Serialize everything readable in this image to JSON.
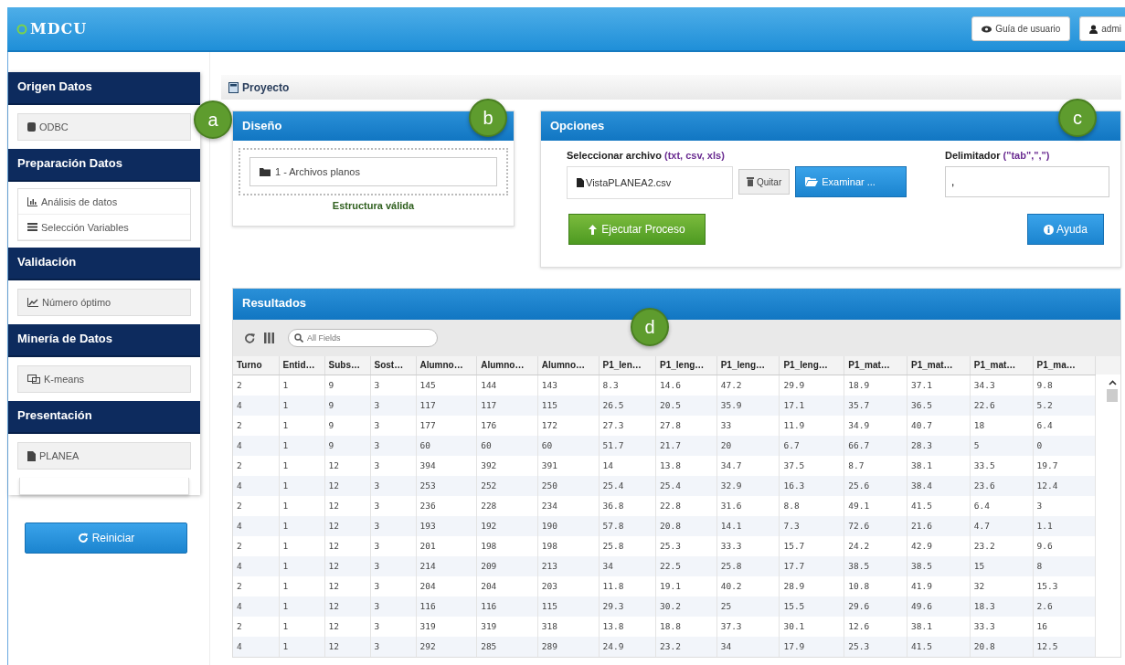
{
  "header": {
    "logo": "MDCU",
    "buttons": [
      {
        "label": "Guía de usuario"
      },
      {
        "label": "admi"
      }
    ]
  },
  "sidebar": {
    "sections": [
      {
        "title": "Origen Datos",
        "items": [
          "ODBC"
        ]
      },
      {
        "title": "Preparación Datos",
        "items": [
          "Análisis de datos",
          "Selección Variables"
        ]
      },
      {
        "title": "Validación",
        "items": [
          "Número óptimo"
        ]
      },
      {
        "title": "Minería de Datos",
        "items": [
          "K-means"
        ]
      },
      {
        "title": "Presentación",
        "items": [
          "PLANEA"
        ]
      }
    ],
    "reset_button": "Reiniciar"
  },
  "project": {
    "title": "Proyecto"
  },
  "design": {
    "title": "Diseño",
    "item": "1 - Archivos planos",
    "status": "Estructura válida"
  },
  "options": {
    "title": "Opciones",
    "file_label": "Seleccionar archivo",
    "file_types": "(txt, csv, xls)",
    "file_value": "VistaPLANEA2.csv",
    "remove_button": "Quitar",
    "browse_button": "Examinar ...",
    "delimiter_label": "Delimitador",
    "delimiter_hint": "(\"tab\",\",\")",
    "delimiter_value": ",",
    "run_button": "Ejecutar Proceso",
    "help_button": "Ayuda"
  },
  "results": {
    "title": "Resultados",
    "search": {
      "placeholder": "All Fields"
    },
    "columns": [
      "Turno",
      "Entid…",
      "Subs…",
      "Sost…",
      "Alumno…",
      "Alumno…",
      "Alumno…",
      "P1_len…",
      "P1_leng…",
      "P1_leng…",
      "P1_leng…",
      "P1_mat…",
      "P1_mat…",
      "P1_mat…",
      "P1_ma…"
    ],
    "rows": [
      [
        "2",
        "1",
        "9",
        "3",
        "145",
        "144",
        "143",
        "8.3",
        "14.6",
        "47.2",
        "29.9",
        "18.9",
        "37.1",
        "34.3",
        "9.8"
      ],
      [
        "4",
        "1",
        "9",
        "3",
        "117",
        "117",
        "115",
        "26.5",
        "20.5",
        "35.9",
        "17.1",
        "35.7",
        "36.5",
        "22.6",
        "5.2"
      ],
      [
        "2",
        "1",
        "9",
        "3",
        "177",
        "176",
        "172",
        "27.3",
        "27.8",
        "33",
        "11.9",
        "34.9",
        "40.7",
        "18",
        "6.4"
      ],
      [
        "4",
        "1",
        "9",
        "3",
        "60",
        "60",
        "60",
        "51.7",
        "21.7",
        "20",
        "6.7",
        "66.7",
        "28.3",
        "5",
        "0"
      ],
      [
        "2",
        "1",
        "12",
        "3",
        "394",
        "392",
        "391",
        "14",
        "13.8",
        "34.7",
        "37.5",
        "8.7",
        "38.1",
        "33.5",
        "19.7"
      ],
      [
        "4",
        "1",
        "12",
        "3",
        "253",
        "252",
        "250",
        "25.4",
        "25.4",
        "32.9",
        "16.3",
        "25.6",
        "38.4",
        "23.6",
        "12.4"
      ],
      [
        "2",
        "1",
        "12",
        "3",
        "236",
        "228",
        "234",
        "36.8",
        "22.8",
        "31.6",
        "8.8",
        "49.1",
        "41.5",
        "6.4",
        "3"
      ],
      [
        "4",
        "1",
        "12",
        "3",
        "193",
        "192",
        "190",
        "57.8",
        "20.8",
        "14.1",
        "7.3",
        "72.6",
        "21.6",
        "4.7",
        "1.1"
      ],
      [
        "2",
        "1",
        "12",
        "3",
        "201",
        "198",
        "198",
        "25.8",
        "25.3",
        "33.3",
        "15.7",
        "24.2",
        "42.9",
        "23.2",
        "9.6"
      ],
      [
        "4",
        "1",
        "12",
        "3",
        "214",
        "209",
        "213",
        "34",
        "22.5",
        "25.8",
        "17.7",
        "38.5",
        "38.5",
        "15",
        "8"
      ],
      [
        "2",
        "1",
        "12",
        "3",
        "204",
        "204",
        "203",
        "11.8",
        "19.1",
        "40.2",
        "28.9",
        "10.8",
        "41.9",
        "32",
        "15.3"
      ],
      [
        "4",
        "1",
        "12",
        "3",
        "116",
        "116",
        "115",
        "29.3",
        "30.2",
        "25",
        "15.5",
        "29.6",
        "49.6",
        "18.3",
        "2.6"
      ],
      [
        "2",
        "1",
        "12",
        "3",
        "319",
        "319",
        "318",
        "13.8",
        "18.8",
        "37.3",
        "30.1",
        "12.6",
        "38.1",
        "33.3",
        "16"
      ],
      [
        "4",
        "1",
        "12",
        "3",
        "292",
        "285",
        "289",
        "24.9",
        "23.2",
        "34",
        "17.9",
        "25.3",
        "41.5",
        "20.8",
        "12.5"
      ]
    ]
  },
  "callouts": [
    "a",
    "b",
    "c",
    "d"
  ]
}
